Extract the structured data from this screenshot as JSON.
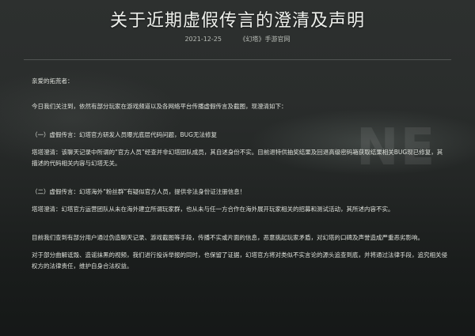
{
  "article": {
    "title": "关于近期虚假传言的澄清及声明",
    "date": "2021-12-25",
    "source": "《幻塔》手游官网",
    "salutation": "亲爱的拓荒者：",
    "intro": "今日我们关注到，依然有部分玩家在游戏频道以及各网络平台传播虚假传言及截图，现澄清如下：",
    "rumor1_heading": "（一）虚假传言：幻塔官方研发人员曝光底层代码问题，BUG无法修复",
    "rumor1_body": "塔塔澄清：该聊天记录中所谓的“官方人员”经查并非幻塔团队成员，其自述身份不实。目前退特供抽奖结果及回退高级密码箱获取结果相关BUG现已修复，其描述的代码相关内容与幻塔无关。",
    "rumor2_heading": "（二）虚假传言：幻塔海外“粉丝群”有疑似官方人员，提供非法身份证注册信息！",
    "rumor2_body": "塔塔澄清：幻塔官方运营团队从未在海外建立所谓玩家群，也从未与任一方合作在海外展开玩家相关的招募和测试活动，其所述内容不实。",
    "statement1": "目前我们查到有部分用户通过伪造聊天记录、游戏截图等手段，传播不实或片面的信息，恶意挑起玩家矛盾，对幻塔的口碑及声誉造成严重恶劣影响。",
    "statement2": "对于部分曲解诋毁、造谣抹黑的视频，我们进行投诉举报的同时，也保留了证据，幻塔官方将对类似不实言论的源头追查到底，并将通过法律手段，追究相关侵权方的法律责任，维护自身合法权益。"
  },
  "background": {
    "deco_text": "NE",
    "colors": {
      "top": "#2d302f",
      "bottom": "#151817",
      "text": "#dfe2dc"
    }
  }
}
